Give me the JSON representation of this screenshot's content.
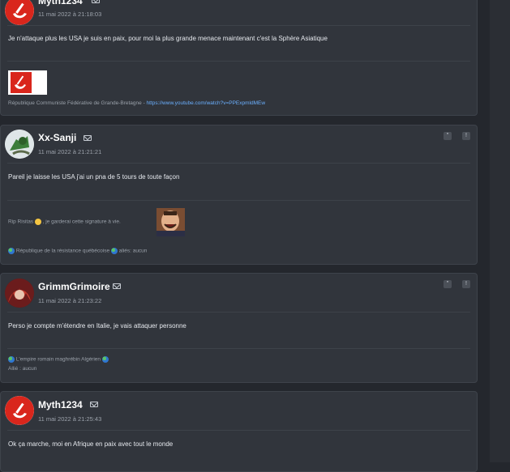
{
  "posts": [
    {
      "author": "Myth1234",
      "date": "11 mai 2022 à 21:18:03",
      "message": "Je n'attaque plus les USA je suis en paix, pour moi la plus grande menace maintenant c'est la Sphère Asiatique",
      "signature_text": "République Communiste Fédérative de Grande-Bretagne - ",
      "signature_link": "https://www.youtube.com/watch?v=PPExpmldMEw"
    },
    {
      "author": "Xx-Sanji",
      "date": "11 mai 2022 à 21:21:21",
      "message": "Pareil je laisse les USA j'ai un pna de 5 tours de toute façon",
      "signature_line1": "Rip Risitas",
      "signature_line1b": ", je garderai cette signature à vie.",
      "signature_line2": "République de la résistance québécoise",
      "signature_line2b": "aliés: aucun"
    },
    {
      "author": "GrimmGrimoire",
      "date": "11 mai 2022 à 21:23:22",
      "message": "Perso je compte m'étendre en Italie, je vais attaquer personne",
      "signature_line1": "L'empire romain maghrébin Algérien",
      "signature_line2": "Allié : aucun"
    },
    {
      "author": "Myth1234",
      "date": "11 mai 2022 à 21:25:43",
      "message": "Ok ça marche, moi en Afrique en paix avec tout le monde"
    }
  ],
  "icons": {
    "quote": "quote-icon",
    "report": "report-icon",
    "mail": "envelope-icon"
  },
  "colors": {
    "background": "#24272d",
    "card": "#31353c",
    "link": "#6bb0ff",
    "flag_red": "#d9261c"
  }
}
